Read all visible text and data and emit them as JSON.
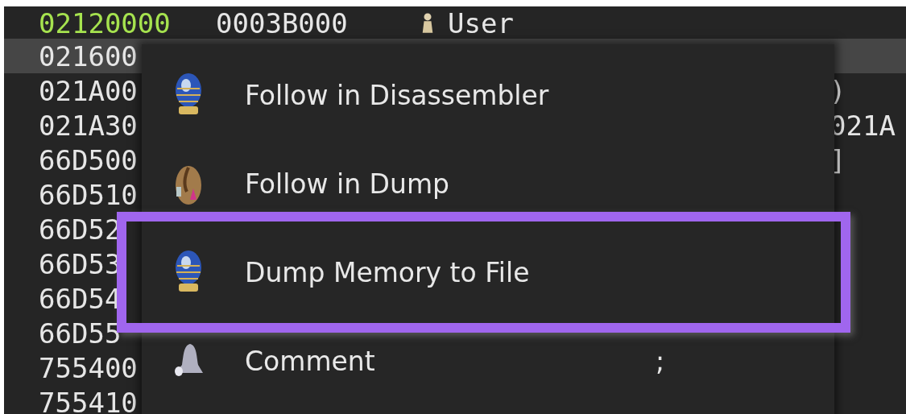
{
  "memory_table": {
    "rows": [
      {
        "address": "02120000",
        "color": "#a6e34f",
        "selected": false,
        "size": "0003B000",
        "info": "User"
      },
      {
        "address": "021600",
        "color": "#e6e6e6",
        "selected": true
      },
      {
        "address": "021A00",
        "color": "#e6e6e6",
        "selected": false,
        "column_4": ")"
      },
      {
        "address": "021A30",
        "color": "#e6e6e6",
        "selected": false,
        "column_4": "021A"
      },
      {
        "address": "66D500",
        "color": "#e6e6e6",
        "selected": false,
        "column_4": "]"
      },
      {
        "address": "66D510",
        "color": "#e6e6e6",
        "selected": false
      },
      {
        "address": "66D52",
        "color": "#e6e6e6",
        "selected": false
      },
      {
        "address": "66D53",
        "color": "#e6e6e6",
        "selected": false
      },
      {
        "address": "66D54",
        "color": "#e6e6e6",
        "selected": false
      },
      {
        "address": "66D55",
        "color": "#e6e6e6",
        "selected": false
      },
      {
        "address": "755400",
        "color": "#e6e6e6",
        "selected": false
      },
      {
        "address": "755410",
        "color": "#e6e6e6",
        "selected": false
      }
    ]
  },
  "context_menu": {
    "items": [
      {
        "label": "Follow in Disassembler",
        "selected": false
      },
      {
        "label": "Follow in Dump",
        "selected": false
      },
      {
        "label": "Dump Memory to File",
        "selected": true
      },
      {
        "label": "Comment",
        "selected": false,
        "shortcut": ";"
      }
    ]
  }
}
